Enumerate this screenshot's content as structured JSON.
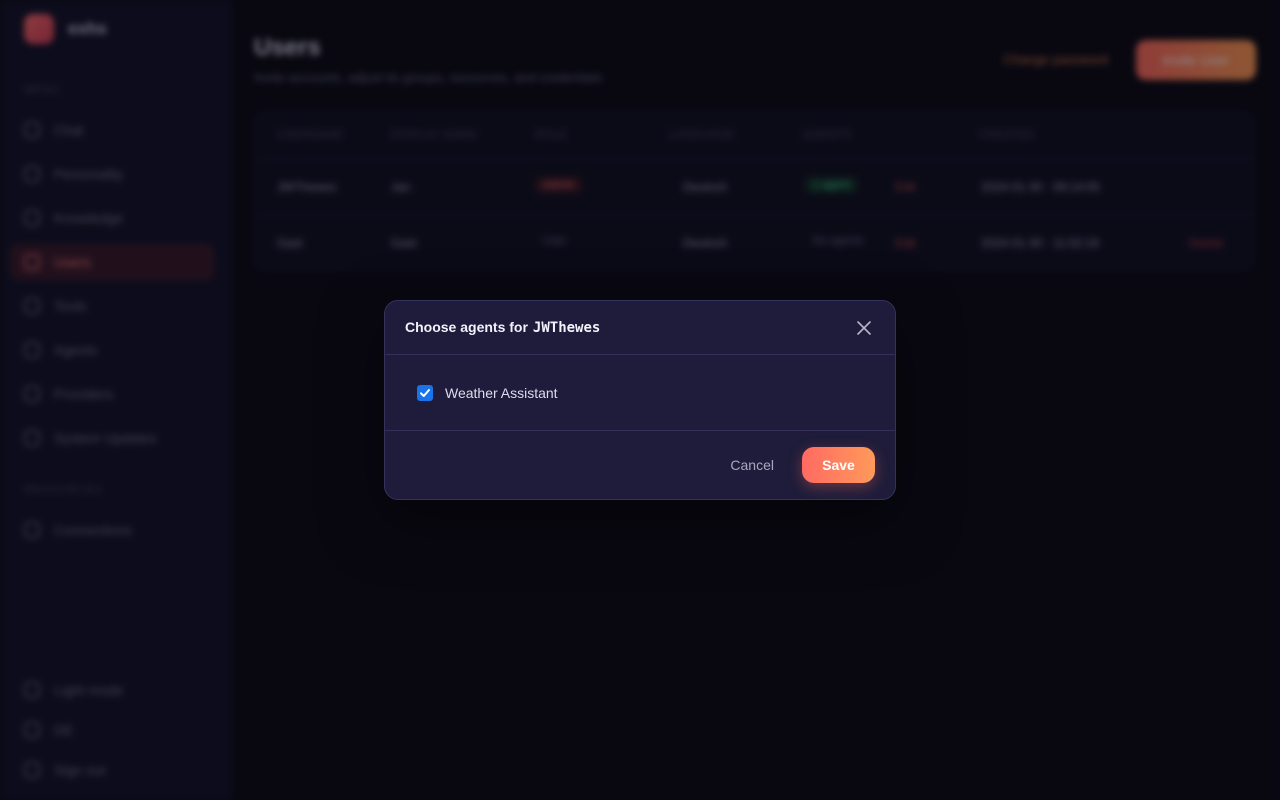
{
  "app": {
    "brand": "exhs",
    "sidebar": {
      "section_main": "MENU",
      "section_settings": "RESOURCES",
      "items": [
        {
          "label": "Chat",
          "icon": "chat-icon"
        },
        {
          "label": "Personality",
          "icon": "person-icon"
        },
        {
          "label": "Knowledge",
          "icon": "book-icon"
        },
        {
          "label": "Users",
          "icon": "users-icon",
          "active": true
        },
        {
          "label": "Tools",
          "icon": "wrench-icon"
        },
        {
          "label": "Agents",
          "icon": "agent-icon"
        },
        {
          "label": "Providers",
          "icon": "cloud-icon"
        },
        {
          "label": "System Updates",
          "icon": "gear-icon"
        }
      ],
      "resource_items": [
        {
          "label": "Connections",
          "icon": "link-icon"
        }
      ],
      "bottom_items": [
        {
          "label": "Light mode",
          "icon": "sun-icon"
        },
        {
          "label": "DE",
          "icon": "language-icon"
        },
        {
          "label": "Sign out",
          "icon": "logout-icon"
        }
      ]
    },
    "page": {
      "title": "Users",
      "subtitle": "Invite accounts, adjust its groups, resources, and credentials",
      "link": "Change password",
      "primary": "Invite User"
    },
    "table": {
      "headers": [
        "USERNAME",
        "DISPLAY NAME",
        "ROLE",
        "LANGUAGE",
        "AGENTS",
        "CREATED"
      ],
      "rows": [
        {
          "username": "JWThewes",
          "display": "Jan",
          "role": "Admin",
          "language": "Deutsch",
          "agents": "1 agent",
          "extra": "Edit",
          "created": "2024-01-30 · 09:14:05",
          "action": ""
        },
        {
          "username": "Gast",
          "display": "Gast",
          "role": "User",
          "language": "Deutsch",
          "agents": "No agents",
          "extra": "Edit",
          "created": "2024-01-30 · 11:52:18",
          "action": "Delete"
        }
      ]
    }
  },
  "modal": {
    "title_prefix": "Choose agents for",
    "title_user": "JWThewes",
    "agents": [
      {
        "label": "Weather Assistant",
        "checked": true
      }
    ],
    "cancel_label": "Cancel",
    "save_label": "Save",
    "checkbox_color": "#1a73e8",
    "save_gradient": [
      "#ff6a62",
      "#ff9a5a"
    ]
  }
}
